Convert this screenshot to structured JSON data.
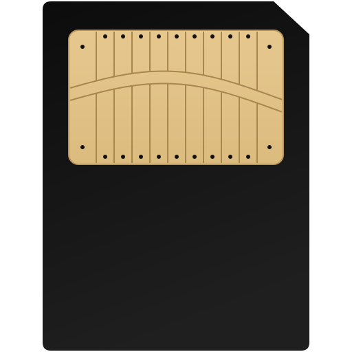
{
  "icon": {
    "name": "smartmedia-memory-card-icon",
    "colors": {
      "card_body": "#1a1a1a",
      "card_shade": "#2a2a2a",
      "contact_fill": "#e3c48a",
      "contact_stroke": "#b8965a",
      "contact_line": "#a8874e",
      "contact_dot": "#111111"
    }
  }
}
